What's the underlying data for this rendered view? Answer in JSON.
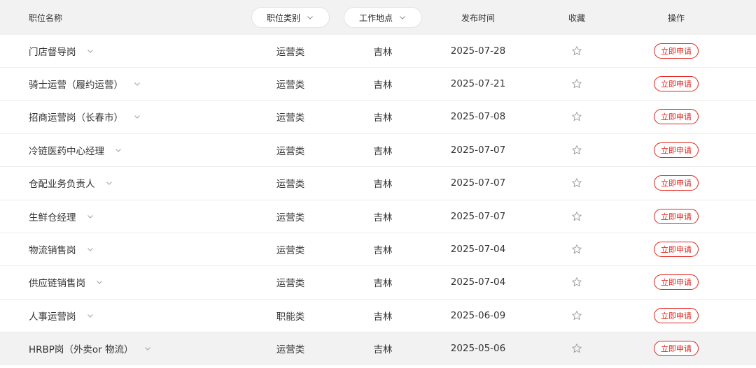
{
  "header": {
    "name_label": "职位名称",
    "category_label": "职位类别",
    "location_label": "工作地点",
    "date_label": "发布时间",
    "favorite_label": "收藏",
    "action_label": "操作",
    "filter_icon": "chevron-down-icon"
  },
  "rows": [
    {
      "name": "门店督导岗",
      "category": "运营类",
      "location": "吉林",
      "date": "2025-07-28",
      "apply": "立即申请"
    },
    {
      "name": "骑士运营（履约运营）",
      "category": "运营类",
      "location": "吉林",
      "date": "2025-07-21",
      "apply": "立即申请"
    },
    {
      "name": "招商运营岗（长春市）",
      "category": "运营类",
      "location": "吉林",
      "date": "2025-07-08",
      "apply": "立即申请"
    },
    {
      "name": "冷链医药中心经理",
      "category": "运营类",
      "location": "吉林",
      "date": "2025-07-07",
      "apply": "立即申请"
    },
    {
      "name": "仓配业务负责人",
      "category": "运营类",
      "location": "吉林",
      "date": "2025-07-07",
      "apply": "立即申请"
    },
    {
      "name": "生鲜仓经理",
      "category": "运营类",
      "location": "吉林",
      "date": "2025-07-07",
      "apply": "立即申请"
    },
    {
      "name": "物流销售岗",
      "category": "运营类",
      "location": "吉林",
      "date": "2025-07-04",
      "apply": "立即申请"
    },
    {
      "name": "供应链销售岗",
      "category": "运营类",
      "location": "吉林",
      "date": "2025-07-04",
      "apply": "立即申请"
    },
    {
      "name": "人事运营岗",
      "category": "职能类",
      "location": "吉林",
      "date": "2025-06-09",
      "apply": "立即申请"
    },
    {
      "name": "HRBP岗（外卖or 物流）",
      "category": "运营类",
      "location": "吉林",
      "date": "2025-05-06",
      "apply": "立即申请"
    }
  ],
  "colors": {
    "accent": "#e2231a",
    "header_bg": "#f2f2f3",
    "divider": "#ededed"
  }
}
